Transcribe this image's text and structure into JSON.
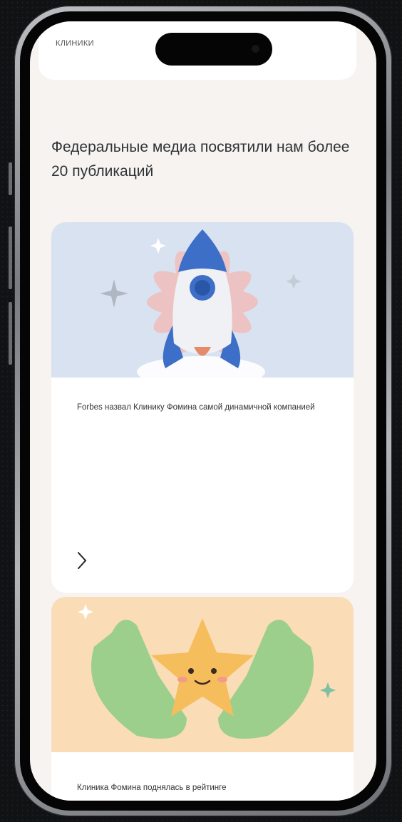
{
  "top_card": {
    "label": "КЛИНИКИ"
  },
  "headline": "Федеральные медиа посвятили нам более 20 публикаций",
  "articles": [
    {
      "text": "Forbes назвал Клинику Фомина самой динамичной компанией",
      "image": "rocket-illustration",
      "bg": "#d9e2f0"
    },
    {
      "text": "Клиника Фомина поднялась в рейтинге",
      "image": "star-in-hands-illustration",
      "bg": "#fadcb6"
    }
  ],
  "icons": {
    "arrow": "chevron-right-icon"
  }
}
